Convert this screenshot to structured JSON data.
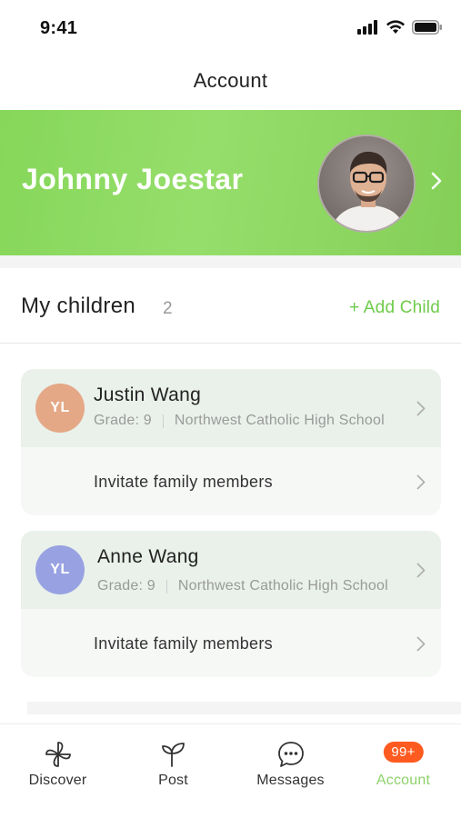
{
  "status_bar": {
    "time": "9:41"
  },
  "nav": {
    "title": "Account"
  },
  "profile": {
    "name": "Johnny Joestar",
    "avatar_icon": "user-photo"
  },
  "children_section": {
    "title": "My children",
    "count": "2",
    "add_label": "+ Add Child",
    "children": [
      {
        "initials": "YL",
        "avatar_color": "#e5a886",
        "name": "Justin Wang",
        "grade": "Grade: 9",
        "school": "Northwest Catholic High School",
        "invite_label": "Invitate family members"
      },
      {
        "initials": "YL",
        "avatar_color": "#98a2e2",
        "name": "Anne Wang",
        "grade": "Grade: 9",
        "school": "Northwest Catholic High School",
        "invite_label": "Invitate family members"
      }
    ]
  },
  "tab_bar": {
    "tabs": [
      {
        "label": "Discover",
        "icon": "pinwheel-icon"
      },
      {
        "label": "Post",
        "icon": "sprout-icon"
      },
      {
        "label": "Messages",
        "icon": "chat-bubble-icon"
      },
      {
        "label": "Account",
        "icon": "badge",
        "badge": "99+",
        "active": true
      }
    ]
  },
  "colors": {
    "accent": "#8fd16b",
    "banner": "#8ed964",
    "badge": "#ff5a1f"
  }
}
